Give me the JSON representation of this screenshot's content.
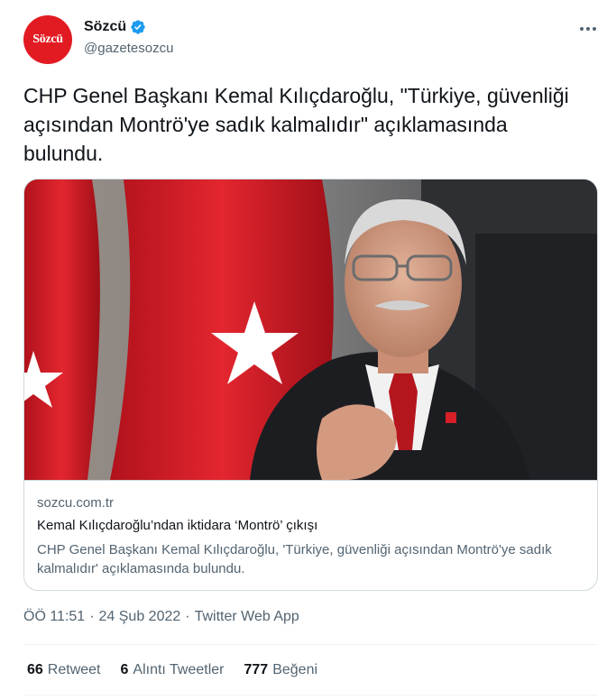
{
  "account": {
    "avatar_text": "Sözcü",
    "display_name": "Sözcü",
    "handle": "@gazetesozcu",
    "verified": true,
    "brand_color": "#e21b23",
    "verified_color": "#1d9bf0"
  },
  "tweet": {
    "text": "CHP Genel Başkanı Kemal Kılıçdaroğlu, \"Türkiye, güvenliği açısından Montrö'ye sadık kalmalıdır\" açıklamasında bulundu."
  },
  "card": {
    "image_icon": "photo-kilicdaroglu-with-turkish-flags",
    "domain": "sozcu.com.tr",
    "title": "Kemal Kılıçdaroğlu’ndan iktidara ‘Montrö’ çıkışı",
    "description": "CHP Genel Başkanı Kemal Kılıçdaroğlu, 'Türkiye, güvenliği açısından Montrö'ye sadık kalmalıdır' açıklamasında bulundu."
  },
  "meta": {
    "time": "ÖÖ 11:51",
    "separator1": "·",
    "date": "24 Şub 2022",
    "separator2": "·",
    "source": "Twitter Web App"
  },
  "stats": {
    "retweets": {
      "count": "66",
      "label": "Retweet"
    },
    "quotes": {
      "count": "6",
      "label": "Alıntı Tweetler"
    },
    "likes": {
      "count": "777",
      "label": "Beğeni"
    }
  }
}
